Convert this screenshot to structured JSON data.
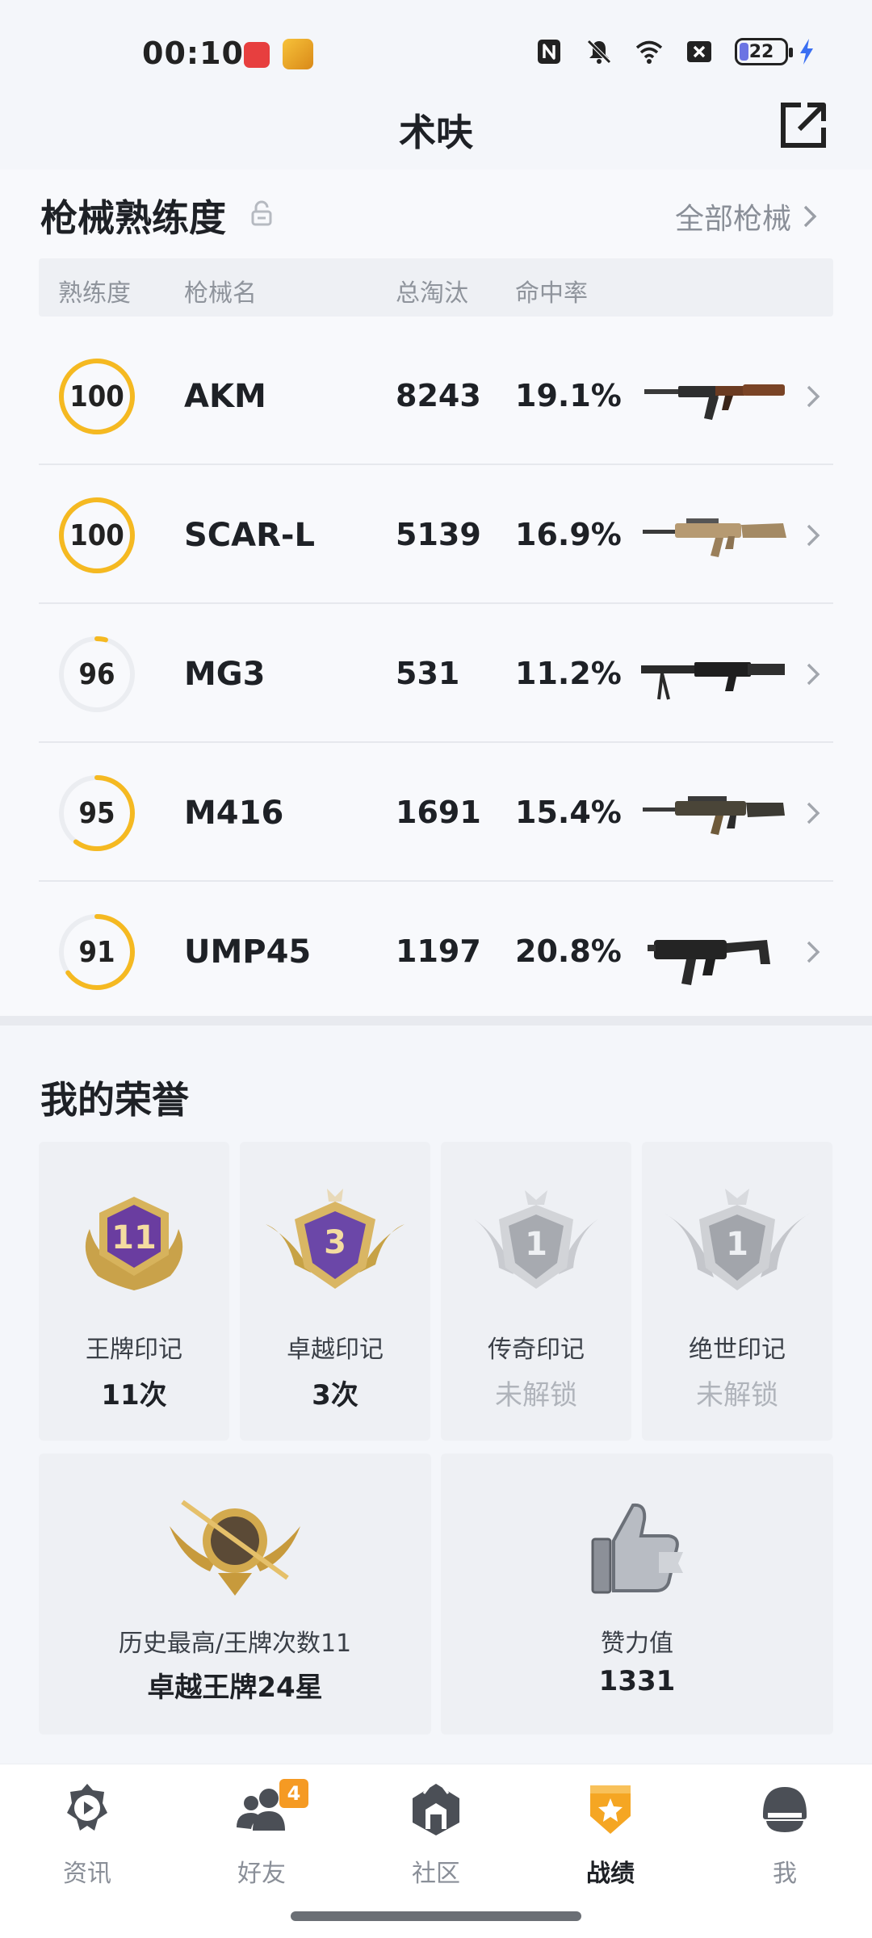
{
  "status": {
    "time": "00:10",
    "battery": "22"
  },
  "header": {
    "title": "术呋"
  },
  "weapons": {
    "title": "枪械熟练度",
    "all_link": "全部枪械",
    "columns": {
      "mastery": "熟练度",
      "name": "枪械名",
      "kills": "总淘汰",
      "accuracy": "命中率"
    },
    "rows": [
      {
        "mastery": "100",
        "progress": 1.0,
        "name": "AKM",
        "kills": "8243",
        "accuracy": "19.1%"
      },
      {
        "mastery": "100",
        "progress": 1.0,
        "name": "SCAR-L",
        "kills": "5139",
        "accuracy": "16.9%"
      },
      {
        "mastery": "96",
        "progress": 0.04,
        "name": "MG3",
        "kills": "531",
        "accuracy": "11.2%"
      },
      {
        "mastery": "95",
        "progress": 0.6,
        "name": "M416",
        "kills": "1691",
        "accuracy": "15.4%"
      },
      {
        "mastery": "91",
        "progress": 0.65,
        "name": "UMP45",
        "kills": "1197",
        "accuracy": "20.8%"
      }
    ]
  },
  "honors": {
    "title": "我的荣誉",
    "badges": [
      {
        "number": "11",
        "label": "王牌印记",
        "value": "11次"
      },
      {
        "number": "3",
        "label": "卓越印记",
        "value": "3次"
      },
      {
        "number": "1",
        "label": "传奇印记",
        "value": "未解锁"
      },
      {
        "number": "1",
        "label": "绝世印记",
        "value": "未解锁"
      }
    ],
    "history": {
      "label": "历史最高/王牌次数11",
      "value": "卓越王牌24星"
    },
    "likes": {
      "label": "赞力值",
      "value": "1331"
    }
  },
  "nav": {
    "items": [
      {
        "label": "资讯"
      },
      {
        "label": "好友",
        "badge": "4"
      },
      {
        "label": "社区"
      },
      {
        "label": "战绩"
      },
      {
        "label": "我"
      }
    ]
  },
  "colors": {
    "accent": "#f5b921",
    "ring_track": "#ebedf1",
    "nav_active": "#f5a623"
  }
}
